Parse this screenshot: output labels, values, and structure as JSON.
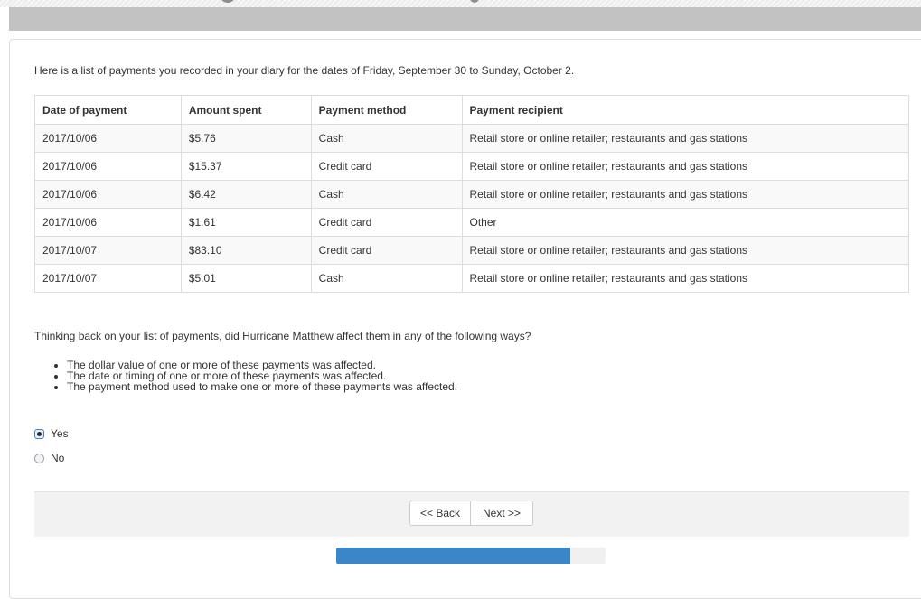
{
  "intro_text": "Here is a list of payments you recorded in your diary for the dates of Friday, September 30 to Sunday, October 2.",
  "table": {
    "headers": [
      "Date of payment",
      "Amount spent",
      "Payment method",
      "Payment recipient"
    ],
    "rows": [
      [
        "2017/10/06",
        "$5.76",
        "Cash",
        "Retail store or online retailer; restaurants and gas stations"
      ],
      [
        "2017/10/06",
        "$15.37",
        "Credit card",
        "Retail store or online retailer; restaurants and gas stations"
      ],
      [
        "2017/10/06",
        "$6.42",
        "Cash",
        "Retail store or online retailer; restaurants and gas stations"
      ],
      [
        "2017/10/06",
        "$1.61",
        "Credit card",
        "Other"
      ],
      [
        "2017/10/07",
        "$83.10",
        "Credit card",
        "Retail store or online retailer; restaurants and gas stations"
      ],
      [
        "2017/10/07",
        "$5.01",
        "Cash",
        "Retail store or online retailer; restaurants and gas stations"
      ]
    ]
  },
  "question": {
    "text": "Thinking back on your list of payments, did Hurricane Matthew affect them in any of the following ways?",
    "bullets": [
      "The dollar value of one or more of these payments was affected.",
      "The date or timing of one or more of these payments was affected.",
      "The payment method used to make one or more of these payments was affected."
    ],
    "options": [
      {
        "label": "Yes",
        "selected": true
      },
      {
        "label": "No",
        "selected": false
      }
    ]
  },
  "nav": {
    "back_label": "<< Back",
    "next_label": "Next >>"
  },
  "progress": {
    "fraction": 0.87,
    "color": "#3b86c8"
  }
}
